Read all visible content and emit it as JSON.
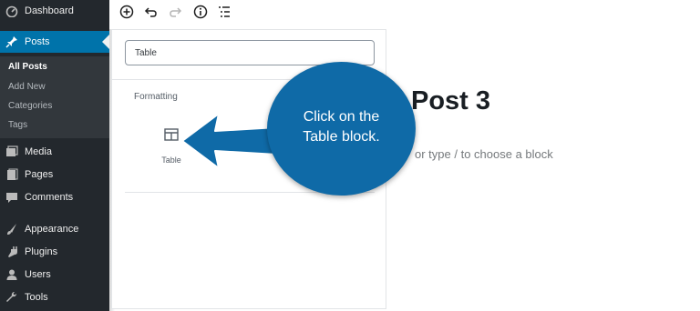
{
  "sidebar": {
    "items": [
      {
        "label": "Dashboard",
        "icon": "dashboard-icon"
      },
      {
        "label": "Posts",
        "icon": "pin-icon",
        "active": true
      },
      {
        "label": "Media",
        "icon": "media-icon"
      },
      {
        "label": "Pages",
        "icon": "pages-icon"
      },
      {
        "label": "Comments",
        "icon": "comments-icon"
      },
      {
        "label": "Appearance",
        "icon": "appearance-icon"
      },
      {
        "label": "Plugins",
        "icon": "plugins-icon"
      },
      {
        "label": "Users",
        "icon": "users-icon"
      },
      {
        "label": "Tools",
        "icon": "tools-icon"
      }
    ],
    "submenu": [
      {
        "label": "All Posts",
        "current": true
      },
      {
        "label": "Add New"
      },
      {
        "label": "Categories"
      },
      {
        "label": "Tags"
      }
    ]
  },
  "toolbar": {
    "buttons": [
      "add-block-icon",
      "undo-icon",
      "redo-icon",
      "info-icon",
      "outline-icon"
    ]
  },
  "inserter": {
    "search_value": "Table",
    "section_title": "Formatting",
    "block_label": "Table"
  },
  "editor": {
    "title": "Post 3",
    "placeholder": "or type / to choose a block"
  },
  "callout": {
    "line1": "Click on the",
    "line2": "Table block."
  },
  "colors": {
    "sidebar_bg": "#23282d",
    "active": "#0073aa",
    "callout": "#0f6aa7"
  }
}
